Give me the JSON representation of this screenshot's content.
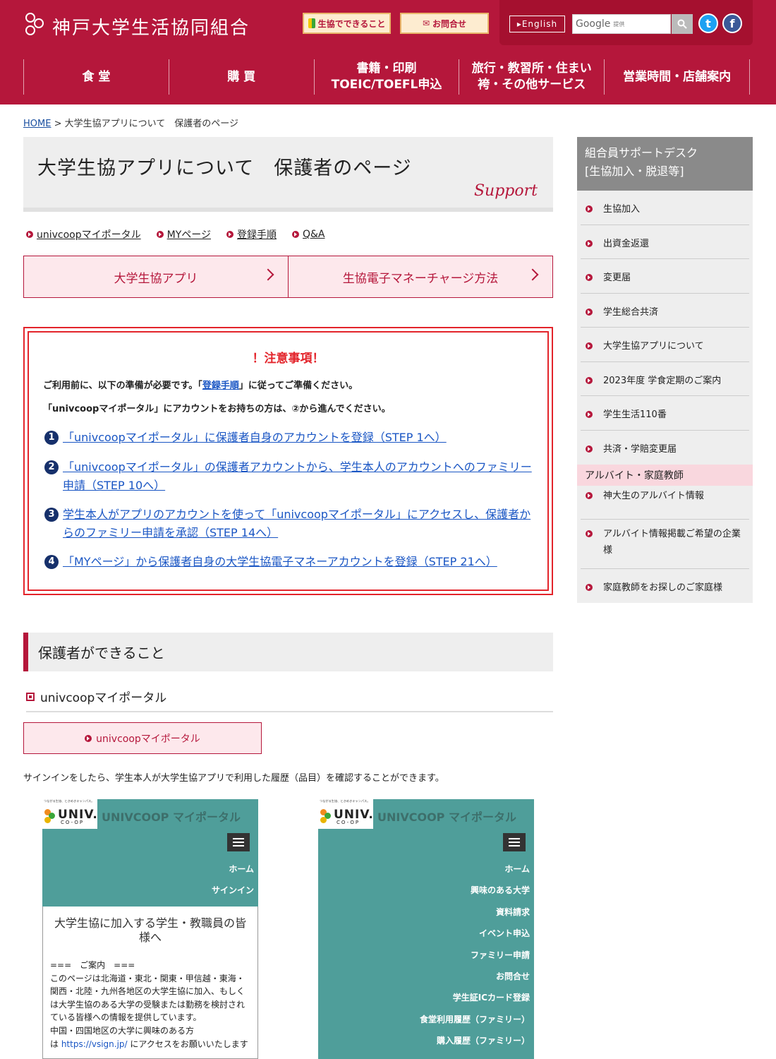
{
  "header": {
    "site_name": "神戸大学生活協同組合",
    "btn_can": "生協でできること",
    "btn_contact": "お問合せ",
    "mail_icon": "✉",
    "english": "▸English",
    "google": "Google",
    "google_sub": "提供",
    "twitter": "t",
    "facebook": "f",
    "accent": "#b5173b"
  },
  "nav": [
    {
      "line1": "食 堂",
      "line2": ""
    },
    {
      "line1": "購 買",
      "line2": ""
    },
    {
      "line1": "書籍・印刷",
      "line2": "TOEIC/TOEFL申込"
    },
    {
      "line1": "旅行・教習所・住まい",
      "line2": "袴・その他サービス"
    },
    {
      "line1": "営業時間・店舗案内",
      "line2": ""
    }
  ],
  "breadcrumb": {
    "home": "HOME",
    "sep": " > ",
    "current": "大学生協アプリについて　保護者のページ"
  },
  "page_title": "大学生協アプリについて　保護者のページ",
  "support_label": "Support",
  "sublinks": [
    "univcoopマイポータル",
    "MYページ",
    "登録手順",
    "Q&A"
  ],
  "bigbtns": [
    "大学生協アプリ",
    "生協電子マネーチャージ方法"
  ],
  "notice": {
    "title": "！注意事項！",
    "p1_pre": "ご利用前に、以下の準備が必要です。「",
    "p1_link": "登録手順",
    "p1_post": "」に従ってご準備ください。",
    "p2": "「univcoopマイポータル」にアカウントをお持ちの方は、②から進んでください。",
    "steps": [
      {
        "num": "1",
        "text": "「univcoopマイポータル」に保護者自身のアカウントを登録（STEP 1へ）"
      },
      {
        "num": "2",
        "text": "「univcoopマイポータル」の保護者アカウントから、学生本人のアカウントへのファミリー申請（STEP 10へ）"
      },
      {
        "num": "3",
        "text": "学生本人がアプリのアカウントを使って「univcoopマイポータル」にアクセスし、保護者からのファミリー申請を承認（STEP 14へ）"
      },
      {
        "num": "4",
        "text": "「MYページ」から保護者自身の大学生協電子マネーアカウントを登録（STEP 21へ）"
      }
    ]
  },
  "section": {
    "heading": "保護者ができること",
    "subheading": "univcoopマイポータル",
    "portal_btn": "univcoopマイポータル",
    "desc": "サインインをしたら、学生本人が大学生協アプリで利用した履歴（品目）を確認することができます。"
  },
  "phone1": {
    "tagline": "つながる生協、ときめきキャンパス。",
    "logo": "UNIV.",
    "logo_sub": "CO-OP",
    "name": "UNIVCOOP マイポータル",
    "menu": [
      "ホーム",
      "サインイン"
    ],
    "heading": "大学生協に加入する学生・教職員の皆様へ",
    "intro_lines": [
      "===　ご案内　===",
      "このページは北海道・東北・関東・甲信越・東海・関西・北陸・九州各地区の大学生協に加入、もしくは大学生協のある大学の受験または勤務を検討されている皆様への情報を提供しています。",
      "中国・四国地区の大学に興味のある方"
    ],
    "intro_pre_link": "は ",
    "intro_link": "https://vsign.jp/",
    "intro_post_link": " にアクセスをお願いいたします"
  },
  "phone2": {
    "tagline": "つながる生協、ときめきキャンパス。",
    "logo": "UNIV.",
    "logo_sub": "CO-OP",
    "name": "UNIVCOOP マイポータル",
    "menu": [
      "ホーム",
      "興味のある大学",
      "資料請求",
      "イベント申込",
      "ファミリー申請",
      "お問合せ",
      "学生証ICカード登録",
      "食堂利用履歴（ファミリー）",
      "購入履歴（ファミリー）"
    ]
  },
  "sidebar": {
    "head_line1": "組合員サポートデスク",
    "head_line2": "[生協加入・脱退等]",
    "items": [
      "生協加入",
      "出資金返還",
      "変更届",
      "学生総合共済",
      "大学生協アプリについて",
      "2023年度 学食定期のご案内",
      "学生生活110番",
      "共済・学賠変更届"
    ],
    "category": "アルバイト・家庭教師",
    "items2": [
      "神大生のアルバイト情報",
      "アルバイト情報掲載ご希望の企業様",
      "家庭教師をお探しのご家庭様"
    ]
  }
}
